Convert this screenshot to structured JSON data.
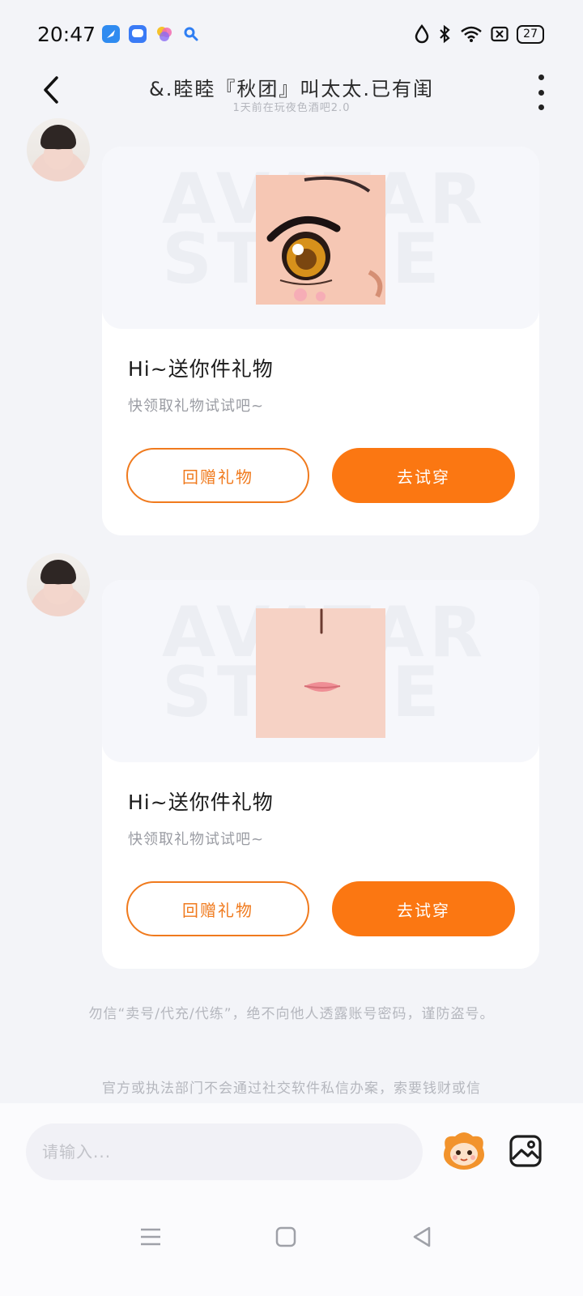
{
  "status_bar": {
    "time": "20:47",
    "battery": "27",
    "notification_icons": [
      "feather-app-icon",
      "chat-bubble-app-icon",
      "colorful-app-icon",
      "search-app-icon"
    ],
    "system_icons": [
      "water-drop-icon",
      "bluetooth-icon",
      "wifi-icon",
      "sim-x-icon",
      "battery-icon"
    ]
  },
  "header": {
    "title": "&.睦睦『秋团』叫太太.已有闺",
    "subtitle": "1天前在玩夜色酒吧2.0"
  },
  "messages": [
    {
      "watermark": "AVATAR STORE",
      "title": "Hi~送你件礼物",
      "desc": "快领取礼物试试吧~",
      "btn_gift": "回赠礼物",
      "btn_try": "去试穿"
    },
    {
      "watermark": "AVATAR STORE",
      "title": "Hi~送你件礼物",
      "desc": "快领取礼物试试吧~",
      "btn_gift": "回赠礼物",
      "btn_try": "去试穿"
    }
  ],
  "notices": [
    "勿信“卖号/代充/代练”，绝不向他人透露账号密码，谨防盗号。",
    "官方或执法部门不会通过社交软件私信办案，索要钱财或信"
  ],
  "input": {
    "placeholder": "请输入..."
  },
  "colors": {
    "accent": "#fb7712",
    "background": "#f3f4f8"
  }
}
